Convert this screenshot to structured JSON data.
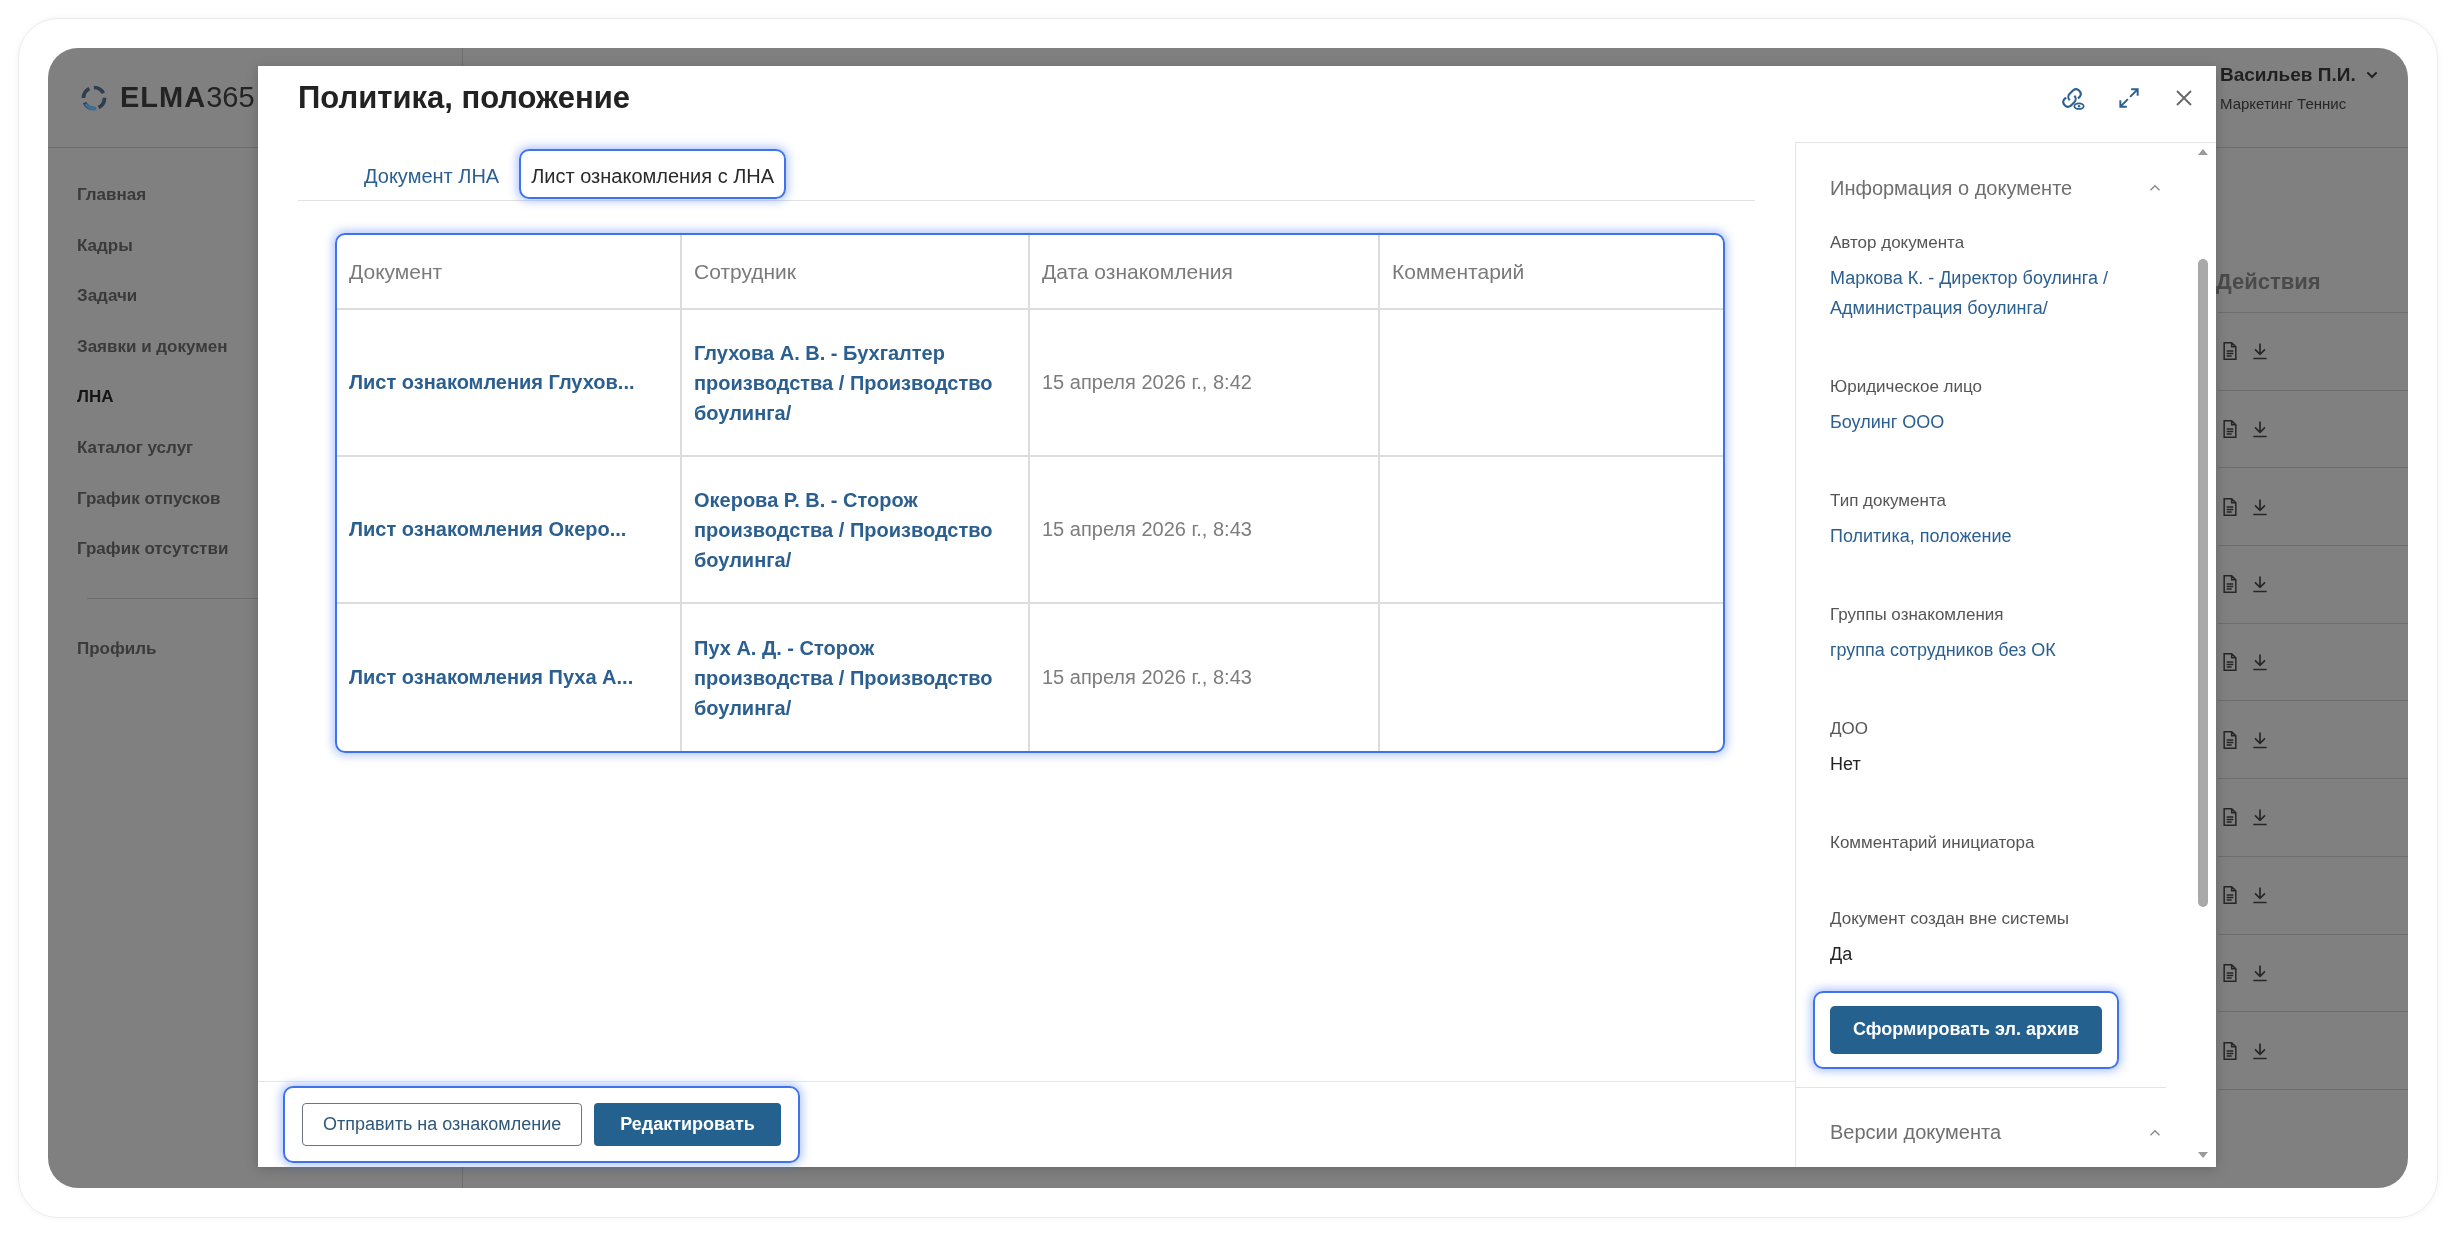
{
  "app": {
    "logo": {
      "name": "ELMA",
      "suffix": "365"
    },
    "sidebar": {
      "items": [
        {
          "label": "Главная",
          "selected": false
        },
        {
          "label": "Кадры",
          "selected": false
        },
        {
          "label": "Задачи",
          "selected": false
        },
        {
          "label": "Заявки и докумен",
          "selected": false
        },
        {
          "label": "ЛНА",
          "selected": true
        },
        {
          "label": "Каталог услуг",
          "selected": false
        },
        {
          "label": "График отпусков",
          "selected": false
        },
        {
          "label": "График отсутстви",
          "selected": false
        }
      ],
      "footer_items": [
        {
          "label": "Профиль",
          "selected": false
        }
      ]
    },
    "user": {
      "name": "Васильев П.И.",
      "department": "Маркетинг Теннис"
    },
    "list": {
      "actions_header": "Действия"
    }
  },
  "modal": {
    "title": "Политика, положение",
    "tabs": [
      {
        "label": "Документ ЛНА",
        "selected": false
      },
      {
        "label": "Лист ознакомления с ЛНА",
        "selected": true
      }
    ],
    "table": {
      "highlighted": true,
      "columns": [
        "Документ",
        "Сотрудник",
        "Дата ознакомления",
        "Комментарий"
      ],
      "rows": [
        {
          "document": "Лист ознакомления Глухов...",
          "employee": "Глухова А. В. - Бухгалтер производства / Производство боулинга/",
          "date": "15 апреля 2026 г., 8:42"
        },
        {
          "document": "Лист ознакомления Океро...",
          "employee": "Окерова Р. В. - Сторож производства / Производство боулинга/",
          "date": "15 апреля 2026 г., 8:43"
        },
        {
          "document": "Лист ознакомления Пуха А...",
          "employee": "Пух А. Д. - Сторож производства / Производство боулинга/",
          "date": "15 апреля 2026 г., 8:43"
        }
      ]
    },
    "footer": {
      "highlighted": true,
      "buttons": [
        {
          "label": "Отправить на ознакомление",
          "kind": "secondary"
        },
        {
          "label": "Редактировать",
          "kind": "primary"
        }
      ]
    },
    "info_panel": {
      "sections": [
        {
          "title": "Информация о документе",
          "expanded": true,
          "fields": [
            {
              "label": "Автор документа",
              "value": "Маркова К. - Директор боулинга / Администрация боулинга/",
              "kind": "link"
            },
            {
              "label": "Юридическое лицо",
              "value": "Боулинг ООО",
              "kind": "link"
            },
            {
              "label": "Тип документа",
              "value": "Политика, положение",
              "kind": "link"
            },
            {
              "label": "Группы ознакомления",
              "value": "группа сотрудников без ОК",
              "kind": "link"
            },
            {
              "label": "ДОО",
              "value": "Нет",
              "kind": "text"
            },
            {
              "label": "Комментарий инициатора"
            },
            {
              "label": "Документ создан вне системы",
              "value": "Да",
              "kind": "text"
            }
          ],
          "button": {
            "label": "Сформировать эл. архив",
            "highlighted": true
          }
        },
        {
          "title": "Версии документа",
          "expanded": true
        }
      ]
    }
  }
}
